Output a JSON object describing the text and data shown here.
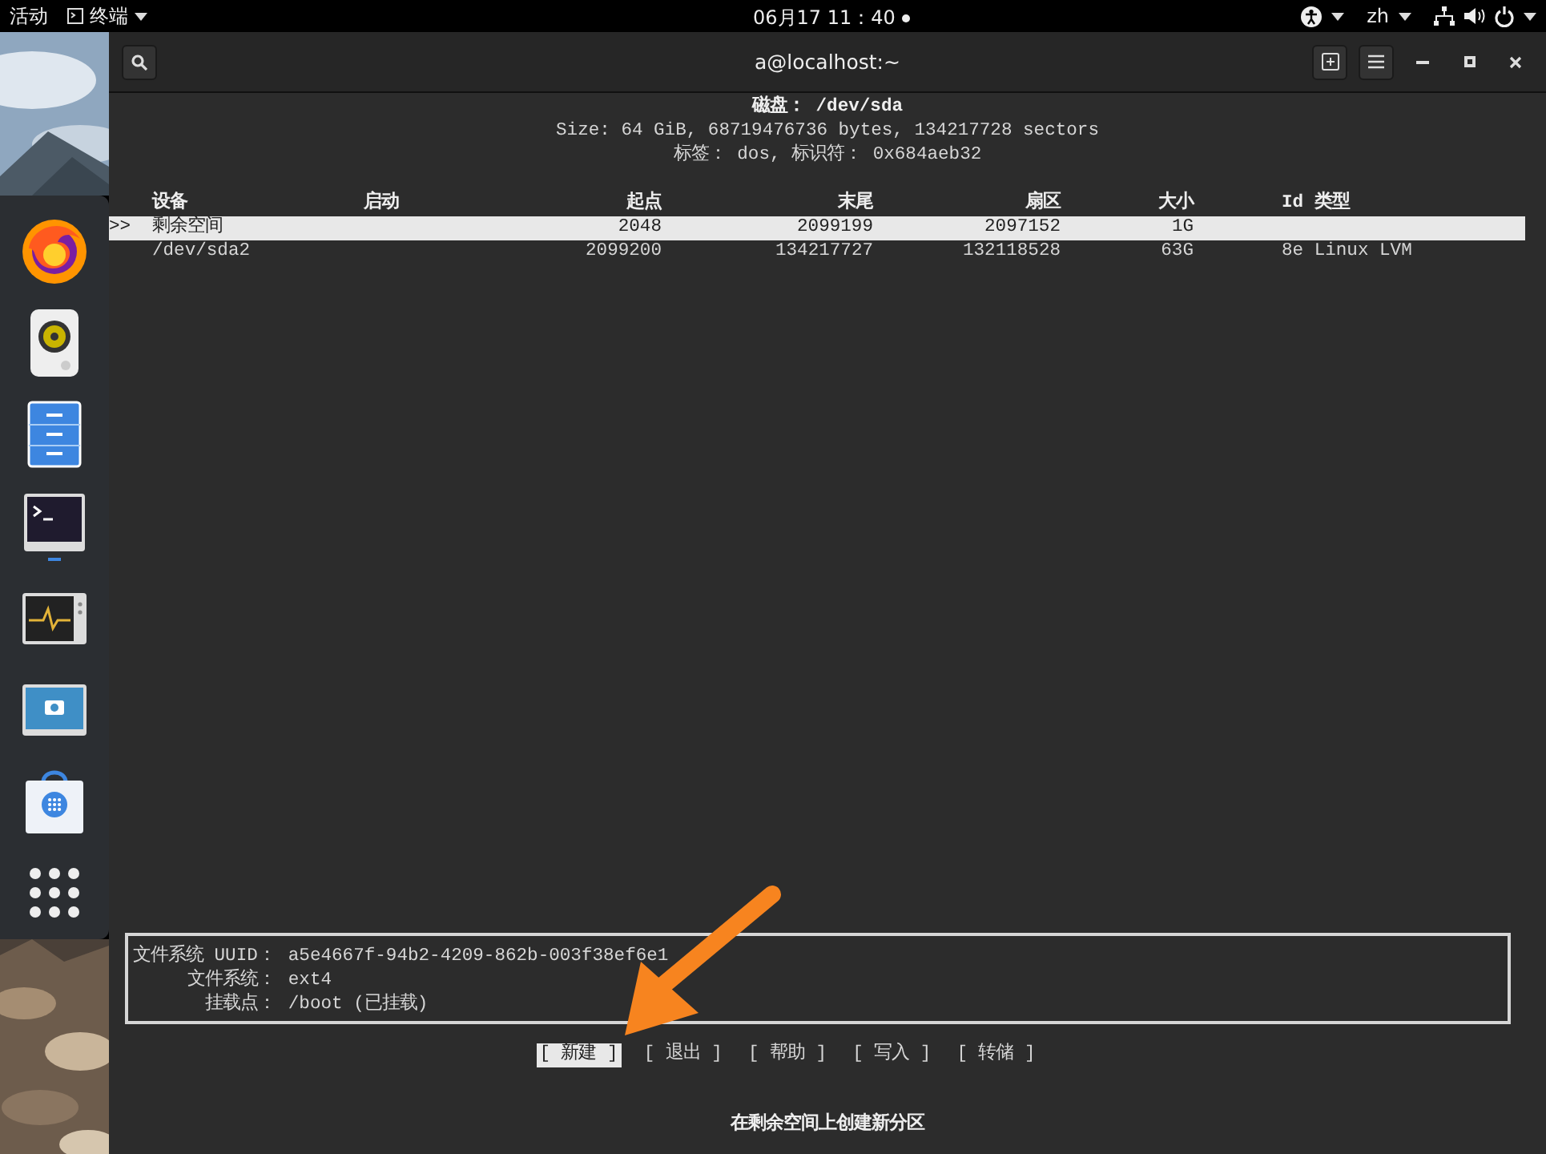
{
  "top_bar": {
    "activities": "活动",
    "app_menu": "终端",
    "clock": "06月17 11：40",
    "language": "zh"
  },
  "dock": {
    "items": [
      {
        "kind": "browser",
        "running": false
      },
      {
        "kind": "speaker",
        "running": false
      },
      {
        "kind": "files",
        "running": false
      },
      {
        "kind": "terminal",
        "running": true
      },
      {
        "kind": "monitor",
        "running": false
      },
      {
        "kind": "camera",
        "running": false
      },
      {
        "kind": "store",
        "running": false
      },
      {
        "kind": "apps",
        "running": false
      }
    ]
  },
  "window": {
    "title": "a@localhost:~"
  },
  "terminal": {
    "disk_title": "磁盘： /dev/sda",
    "size_line": "Size: 64 GiB, 68719476736 bytes, 134217728 sectors",
    "label_line": "标签： dos, 标识符： 0x684aeb32",
    "cursor": ">>",
    "columns": [
      "设备",
      "启动",
      "起点",
      "末尾",
      "扇区",
      "大小",
      "Id 类型"
    ],
    "rows": [
      {
        "selected": true,
        "cells": [
          "剩余空间",
          "",
          "2048",
          "2099199",
          "2097152",
          "1G",
          ""
        ]
      },
      {
        "selected": false,
        "cells": [
          "/dev/sda2",
          "",
          "2099200",
          "134217727",
          "132118528",
          "63G",
          "8e Linux LVM"
        ]
      }
    ],
    "info": [
      {
        "label": "文件系统 UUID：",
        "value": "a5e4667f-94b2-4209-862b-003f38ef6e1"
      },
      {
        "label": "文件系统：",
        "value": "ext4"
      },
      {
        "label": "挂载点：",
        "value": "/boot (已挂载)"
      }
    ],
    "actions": [
      {
        "label": "[ 新建 ]",
        "selected": true
      },
      {
        "label": "[ 退出 ]",
        "selected": false
      },
      {
        "label": "[ 帮助 ]",
        "selected": false
      },
      {
        "label": "[ 写入 ]",
        "selected": false
      },
      {
        "label": "[ 转储 ]",
        "selected": false
      }
    ],
    "hint": "在剩余空间上创建新分区"
  }
}
